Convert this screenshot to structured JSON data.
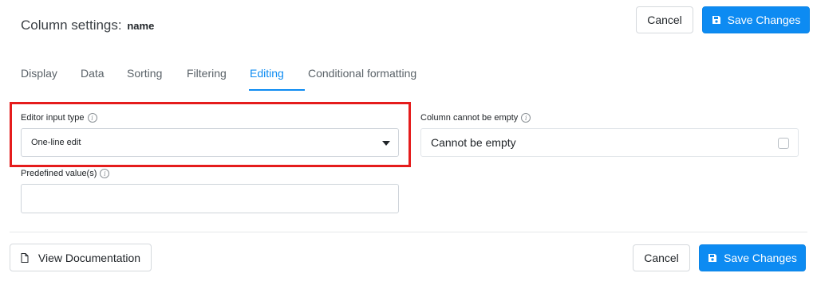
{
  "header": {
    "title_prefix": "Column settings:",
    "column_name": "name",
    "cancel_label": "Cancel",
    "save_label": "Save Changes"
  },
  "tabs": [
    {
      "label": "Display",
      "active": false
    },
    {
      "label": "Data",
      "active": false
    },
    {
      "label": "Sorting",
      "active": false
    },
    {
      "label": "Filtering",
      "active": false
    },
    {
      "label": "Editing",
      "active": true
    },
    {
      "label": "Conditional formatting",
      "active": false
    }
  ],
  "editing": {
    "editor_input_type_label": "Editor input type",
    "editor_input_type_value": "One-line edit",
    "predefined_values_label": "Predefined value(s)",
    "predefined_values_value": "",
    "cannot_be_empty_label": "Column cannot be empty",
    "cannot_be_empty_text": "Cannot be empty",
    "cannot_be_empty_checked": false,
    "info_glyph": "i"
  },
  "footer": {
    "view_docs_label": "View Documentation",
    "cancel_label": "Cancel",
    "save_label": "Save Changes"
  },
  "colors": {
    "primary": "#0d8bf2",
    "highlight": "#e51c1c"
  },
  "icons": {
    "save": "floppy-disk-icon",
    "docs": "document-icon",
    "info": "info-circle-icon",
    "select": "caret-down-icon"
  }
}
